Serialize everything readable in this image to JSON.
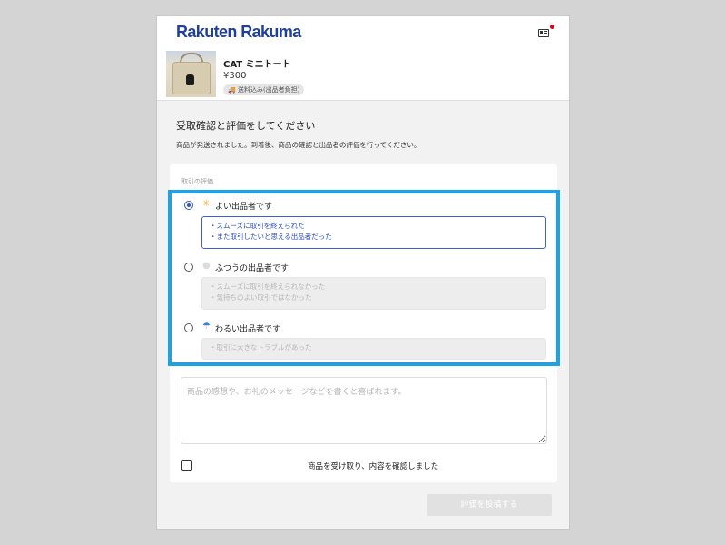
{
  "header": {
    "logo": "Rakuten Rakuma",
    "profile_icon": "profile-card-icon",
    "notification_color": "#e0001a"
  },
  "product": {
    "name": "CAT ミニトート",
    "price": "¥300",
    "shipping_badge": "🚚 送料込み(出品者負担)"
  },
  "section": {
    "title": "受取確認と評価をしてください",
    "description": "商品が発送されました。到着後、商品の確認と出品者の評価を行ってください。"
  },
  "rating": {
    "label": "取引の評価",
    "selected": "good",
    "options": [
      {
        "key": "good",
        "icon": "sun-icon",
        "label": "よい出品者です",
        "lines": [
          "・スムーズに取引を終えられた",
          "・また取引したいと思える出品者だった"
        ]
      },
      {
        "key": "normal",
        "icon": "cloud-icon",
        "label": "ふつうの出品者です",
        "lines": [
          "・スムーズに取引を終えられなかった",
          "・気持ちのよい取引ではなかった"
        ]
      },
      {
        "key": "bad",
        "icon": "umbrella-icon",
        "label": "わるい出品者です",
        "lines": [
          "・取引に大きなトラブルがあった"
        ]
      }
    ]
  },
  "comment": {
    "placeholder": "商品の感想や、お礼のメッセージなどを書くと喜ばれます。",
    "value": ""
  },
  "confirm": {
    "label": "商品を受け取り、内容を確認しました",
    "checked": false
  },
  "submit": {
    "label": "評価を投稿する",
    "enabled": false
  },
  "colors": {
    "brand": "#1f3f9e",
    "accent": "#3056c9",
    "highlight": "#1aa3e8"
  }
}
